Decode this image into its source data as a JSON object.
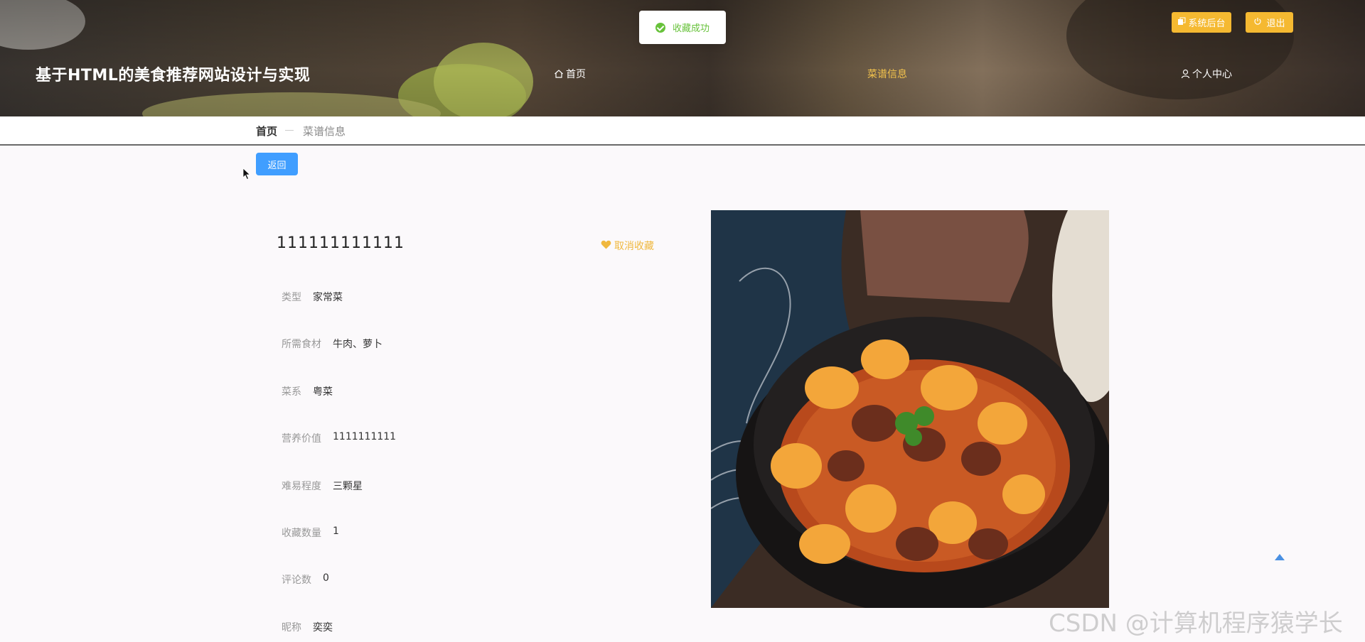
{
  "site": {
    "title": "基于HTML的美食推荐网站设计与实现"
  },
  "nav": [
    {
      "label": "首页",
      "icon": "home-icon"
    },
    {
      "label": "菜谱信息",
      "active": true
    },
    {
      "label": "个人中心",
      "icon": "user-icon"
    }
  ],
  "top_buttons": {
    "admin": "系统后台",
    "logout": "退出"
  },
  "toast": {
    "message": "收藏成功",
    "color": "#67c23a"
  },
  "breadcrumb": {
    "home": "首页",
    "current": "菜谱信息"
  },
  "back_button": "返回",
  "recipe": {
    "title": "111111111111",
    "unfavorite": "取消收藏",
    "fields": [
      {
        "label": "类型",
        "value": "家常菜"
      },
      {
        "label": "所需食材",
        "value": "牛肉、萝卜"
      },
      {
        "label": "菜系",
        "value": "粤菜"
      },
      {
        "label": "营养价值",
        "value": "1111111111"
      },
      {
        "label": "难易程度",
        "value": "三颗星"
      },
      {
        "label": "收藏数量",
        "value": "1"
      },
      {
        "label": "评论数",
        "value": "0"
      },
      {
        "label": "昵称",
        "value": "奕奕"
      }
    ]
  },
  "watermark": "CSDN @计算机程序猿学长",
  "colors": {
    "accent": "#f5b931",
    "active_nav": "#f2c24c",
    "primary_button": "#409eff"
  }
}
